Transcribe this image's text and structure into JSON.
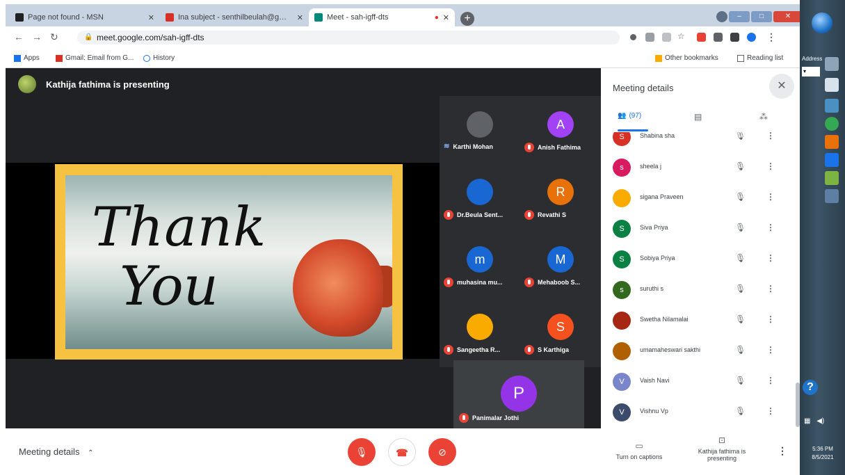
{
  "browser": {
    "tabs": [
      {
        "title": "Page not found - MSN",
        "color": "#202124"
      },
      {
        "title": "Ina subject - senthilbeulah@gmail.com",
        "color": "#d93025"
      },
      {
        "title": "Meet - sah-igff-dts",
        "color": "#00897b"
      }
    ],
    "url": "meet.google.com/sah-igff-dts",
    "bookmarks": {
      "apps": "Apps",
      "gmail": "Gmail: Email from G...",
      "history": "History",
      "other": "Other bookmarks",
      "reading": "Reading list"
    }
  },
  "meet": {
    "presenting_banner": "Kathija fathima is presenting",
    "slide": {
      "line1": "Thank",
      "line2": "You"
    },
    "tiles": [
      {
        "name": "Karthi Mohan",
        "initial": "",
        "color": "#5f6368",
        "speaking": true
      },
      {
        "name": "Anish Fathima",
        "initial": "A",
        "color": "#a142f4",
        "speaking": false
      },
      {
        "name": "Dr.Beula Sent...",
        "initial": "",
        "color": "#1967d2",
        "speaking": false
      },
      {
        "name": "Revathi S",
        "initial": "R",
        "color": "#e8710a",
        "speaking": false
      },
      {
        "name": "muhasina mu...",
        "initial": "m",
        "color": "#1967d2",
        "speaking": false
      },
      {
        "name": "Mehaboob S...",
        "initial": "M",
        "color": "#1967d2",
        "speaking": false
      },
      {
        "name": "Sangeetha R...",
        "initial": "",
        "color": "#f9ab00",
        "speaking": false
      },
      {
        "name": "S Karthiga",
        "initial": "S",
        "color": "#f4511e",
        "speaking": false
      }
    ],
    "big_tile": {
      "name": "Panimalar Jothi",
      "initial": "P",
      "color": "#9334e6"
    }
  },
  "panel": {
    "title": "Meeting details",
    "people_count": "(97)",
    "participants": [
      {
        "name": "Shabina sha",
        "initial": "S",
        "color": "#d93025"
      },
      {
        "name": "sheela j",
        "initial": "s",
        "color": "#d81b60"
      },
      {
        "name": "sigana Praveen",
        "initial": "",
        "color": "#f9ab00"
      },
      {
        "name": "Siva Priya",
        "initial": "S",
        "color": "#0b8043"
      },
      {
        "name": "Sobiya Priya",
        "initial": "S",
        "color": "#0b8043"
      },
      {
        "name": "suruthi s",
        "initial": "s",
        "color": "#33691e"
      },
      {
        "name": "Swetha Nilamalai",
        "initial": "",
        "color": "#a52714"
      },
      {
        "name": "umamaheswari sakthi",
        "initial": "",
        "color": "#b06000"
      },
      {
        "name": "Vaish Navi",
        "initial": "V",
        "color": "#7986cb"
      },
      {
        "name": "Vishnu Vp",
        "initial": "V",
        "color": "#3c4a6b"
      }
    ]
  },
  "bottom": {
    "meeting_details": "Meeting details",
    "captions": "Turn on captions",
    "presenting": "Kathija fathima is presenting"
  },
  "taskbar": {
    "address_label": "Address",
    "address_value": "▾",
    "time": "5:36 PM",
    "date": "8/5/2021"
  }
}
